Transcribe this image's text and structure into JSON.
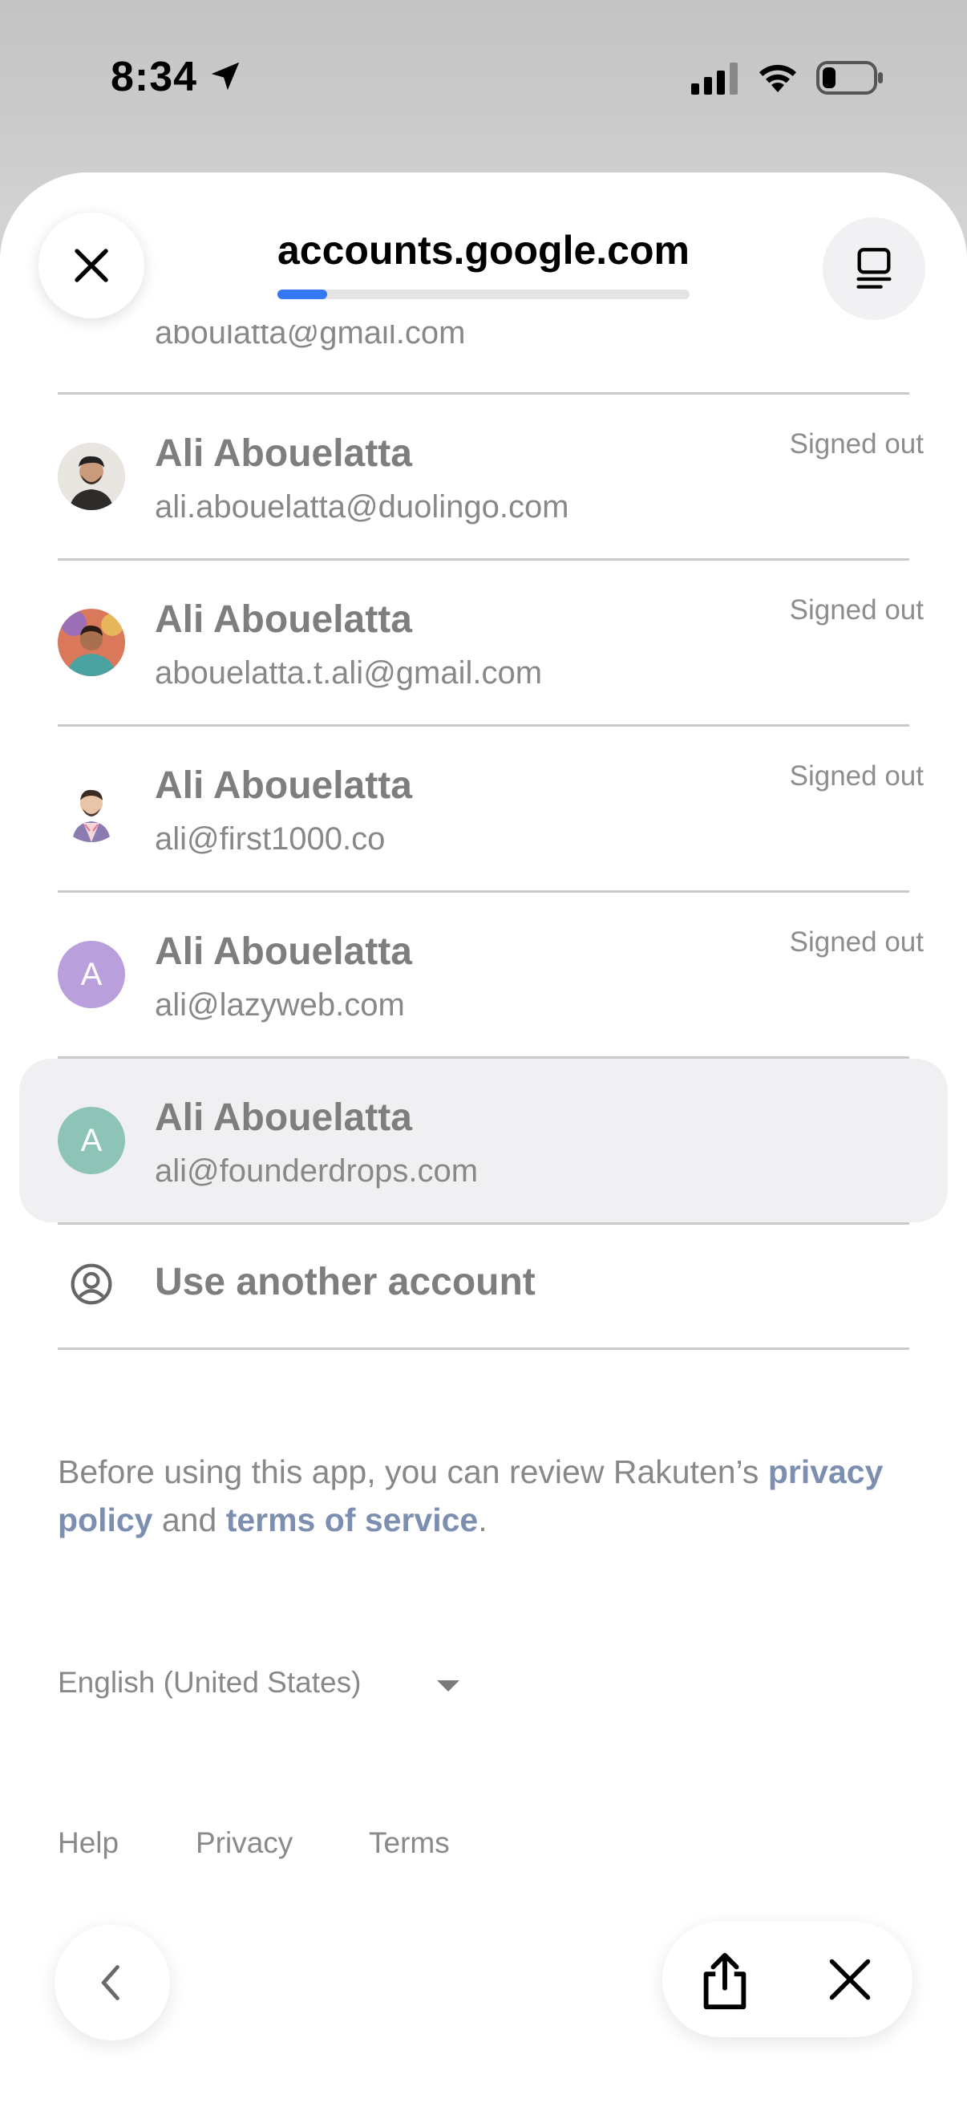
{
  "status_bar": {
    "time": "8:34"
  },
  "header": {
    "url": "accounts.google.com",
    "progress_fraction": 0.12
  },
  "partial_row": {
    "email": "aboulatta@gmail.com"
  },
  "accounts": [
    {
      "name": "Ali Abouelatta",
      "email": "ali.abouelatta@duolingo.com",
      "status": "Signed out"
    },
    {
      "name": "Ali Abouelatta",
      "email": "abouelatta.t.ali@gmail.com",
      "status": "Signed out"
    },
    {
      "name": "Ali Abouelatta",
      "email": "ali@first1000.co",
      "status": "Signed out"
    },
    {
      "name": "Ali Abouelatta",
      "email": "ali@lazyweb.com",
      "status": "Signed out",
      "initial": "A",
      "avatar_color": "#b9a0dc"
    },
    {
      "name": "Ali Abouelatta",
      "email": "ali@founderdrops.com",
      "status": "",
      "initial": "A",
      "avatar_color": "#8ec4b8"
    }
  ],
  "use_another": {
    "label": "Use another account"
  },
  "policy": {
    "prefix": "Before using this app, you can review Rakuten’s ",
    "privacy_link": "privacy policy",
    "middle": " and ",
    "terms_link": "terms of service",
    "suffix": "."
  },
  "language": {
    "selected": "English (United States)"
  },
  "footer": {
    "help": "Help",
    "privacy": "Privacy",
    "terms": "Terms"
  },
  "colors": {
    "accent": "#3478f6",
    "link": "#7d8fb0"
  }
}
